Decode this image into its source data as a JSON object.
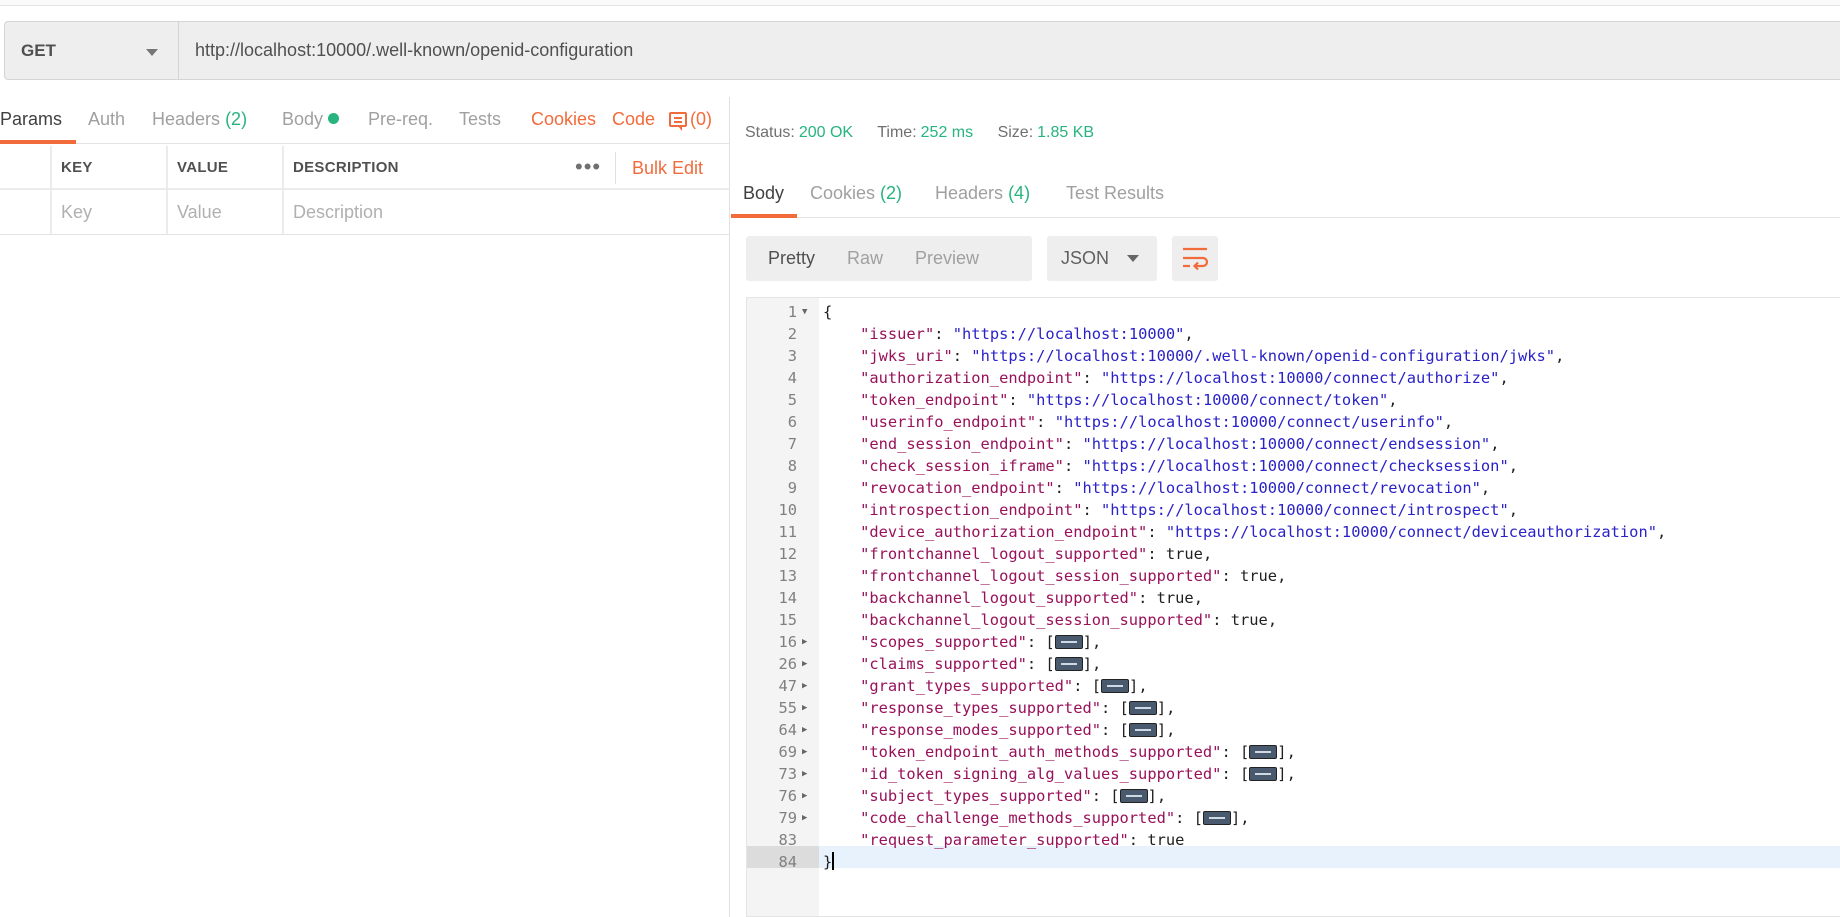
{
  "request": {
    "method": "GET",
    "url": "http://localhost:10000/.well-known/openid-configuration"
  },
  "request_tabs": {
    "params": "Params",
    "auth": "Auth",
    "headers": "Headers",
    "headers_count": "(2)",
    "body": "Body",
    "prereq": "Pre-req.",
    "tests": "Tests",
    "cookies": "Cookies",
    "code": "Code",
    "comments": "(0)"
  },
  "params_table": {
    "key_header": "KEY",
    "value_header": "VALUE",
    "description_header": "DESCRIPTION",
    "more_label": "•••",
    "bulk_edit": "Bulk Edit",
    "key_placeholder": "Key",
    "value_placeholder": "Value",
    "description_placeholder": "Description"
  },
  "response_status": {
    "status_label": "Status:",
    "status_value": "200 OK",
    "time_label": "Time:",
    "time_value": "252 ms",
    "size_label": "Size:",
    "size_value": "1.85 KB"
  },
  "response_tabs": {
    "body": "Body",
    "cookies": "Cookies",
    "cookies_count": "(2)",
    "headers": "Headers",
    "headers_count": "(4)",
    "test_results": "Test Results"
  },
  "view": {
    "pretty": "Pretty",
    "raw": "Raw",
    "preview": "Preview",
    "format": "JSON"
  },
  "colors": {
    "accent": "#f26b3a",
    "success": "#26b47f",
    "json_key": "#98115a",
    "json_string": "#2a22c8"
  },
  "json_lines": [
    {
      "n": "1",
      "fold": "open",
      "open": "{"
    },
    {
      "n": "2",
      "key": "issuer",
      "str": "https://localhost:10000",
      "comma": true
    },
    {
      "n": "3",
      "key": "jwks_uri",
      "str": "https://localhost:10000/.well-known/openid-configuration/jwks",
      "comma": true
    },
    {
      "n": "4",
      "key": "authorization_endpoint",
      "str": "https://localhost:10000/connect/authorize",
      "comma": true
    },
    {
      "n": "5",
      "key": "token_endpoint",
      "str": "https://localhost:10000/connect/token",
      "comma": true
    },
    {
      "n": "6",
      "key": "userinfo_endpoint",
      "str": "https://localhost:10000/connect/userinfo",
      "comma": true
    },
    {
      "n": "7",
      "key": "end_session_endpoint",
      "str": "https://localhost:10000/connect/endsession",
      "comma": true
    },
    {
      "n": "8",
      "key": "check_session_iframe",
      "str": "https://localhost:10000/connect/checksession",
      "comma": true
    },
    {
      "n": "9",
      "key": "revocation_endpoint",
      "str": "https://localhost:10000/connect/revocation",
      "comma": true
    },
    {
      "n": "10",
      "key": "introspection_endpoint",
      "str": "https://localhost:10000/connect/introspect",
      "comma": true
    },
    {
      "n": "11",
      "key": "device_authorization_endpoint",
      "str": "https://localhost:10000/connect/deviceauthorization",
      "comma": true
    },
    {
      "n": "12",
      "key": "frontchannel_logout_supported",
      "lit": "true",
      "comma": true
    },
    {
      "n": "13",
      "key": "frontchannel_logout_session_supported",
      "lit": "true",
      "comma": true
    },
    {
      "n": "14",
      "key": "backchannel_logout_supported",
      "lit": "true",
      "comma": true
    },
    {
      "n": "15",
      "key": "backchannel_logout_session_supported",
      "lit": "true",
      "comma": true
    },
    {
      "n": "16",
      "fold": "closed",
      "key": "scopes_supported",
      "array": true,
      "comma": true
    },
    {
      "n": "26",
      "fold": "closed",
      "key": "claims_supported",
      "array": true,
      "comma": true
    },
    {
      "n": "47",
      "fold": "closed",
      "key": "grant_types_supported",
      "array": true,
      "comma": true
    },
    {
      "n": "55",
      "fold": "closed",
      "key": "response_types_supported",
      "array": true,
      "comma": true
    },
    {
      "n": "64",
      "fold": "closed",
      "key": "response_modes_supported",
      "array": true,
      "comma": true
    },
    {
      "n": "69",
      "fold": "closed",
      "key": "token_endpoint_auth_methods_supported",
      "array": true,
      "comma": true
    },
    {
      "n": "73",
      "fold": "closed",
      "key": "id_token_signing_alg_values_supported",
      "array": true,
      "comma": true
    },
    {
      "n": "76",
      "fold": "closed",
      "key": "subject_types_supported",
      "array": true,
      "comma": true
    },
    {
      "n": "79",
      "fold": "closed",
      "key": "code_challenge_methods_supported",
      "array": true,
      "comma": true
    },
    {
      "n": "83",
      "key": "request_parameter_supported",
      "lit": "true",
      "comma": false
    },
    {
      "n": "84",
      "close": "}"
    }
  ]
}
